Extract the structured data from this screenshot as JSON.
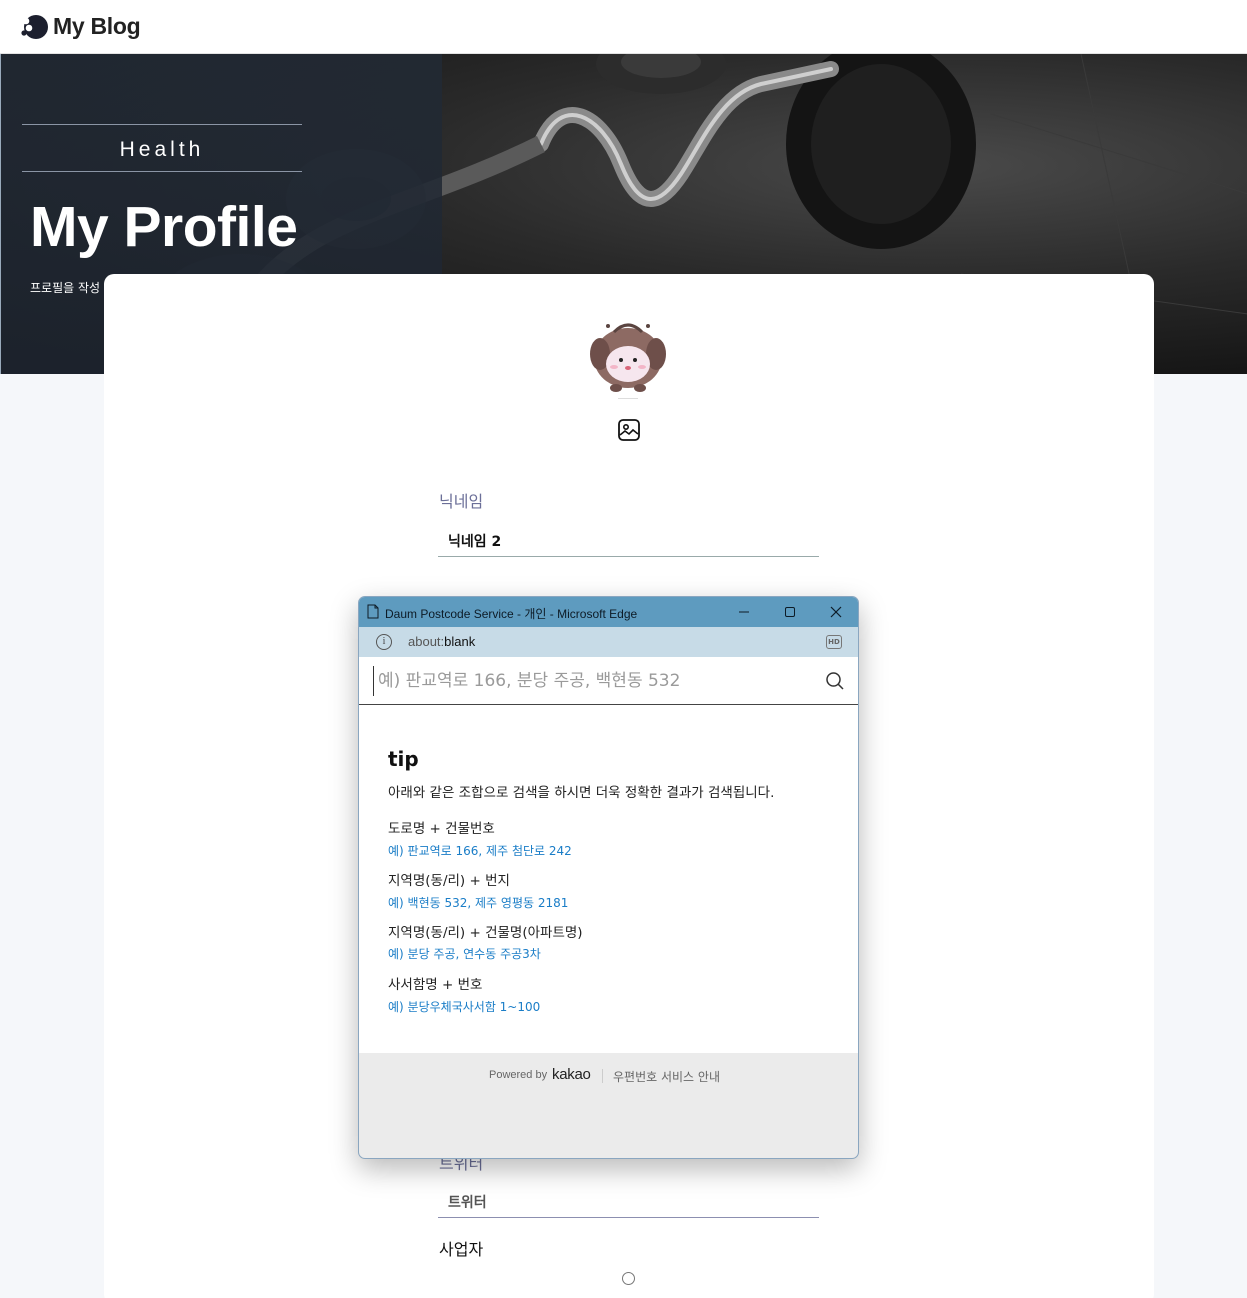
{
  "nav": {
    "logo_text": "My Blog"
  },
  "hero": {
    "category": "Health",
    "title": "My Profile",
    "subtitle": "프로필을 작성"
  },
  "profile": {
    "nickname_label": "닉네임",
    "nickname_value": "닉네임 2",
    "twitter_label": "트위터",
    "twitter_placeholder": "트위터",
    "business_label": "사업자"
  },
  "popup": {
    "window_title": "Daum Postcode Service - 개인 - Microsoft Edge",
    "url_prefix": "about:",
    "url_main": "blank",
    "hd_badge": "HD",
    "search_placeholder": "예) 판교역로 166, 분당 주공, 백현동 532",
    "tip_title": "tip",
    "tip_desc": "아래와 같은 조합으로 검색을 하시면 더욱 정확한 결과가 검색됩니다.",
    "tips": [
      {
        "heading": "도로명 + 건물번호",
        "example": "예) 판교역로 166,  제주 첨단로 242"
      },
      {
        "heading": "지역명(동/리) + 번지",
        "example": "예) 백현동 532,  제주 영평동 2181"
      },
      {
        "heading": "지역명(동/리) + 건물명(아파트명)",
        "example": "예) 분당 주공,  연수동 주공3차"
      },
      {
        "heading": "사서함명 + 번호",
        "example": "예) 분당우체국사서함 1~100"
      }
    ],
    "powered_by": "Powered by",
    "brand": "kakao",
    "service_link": "우편번호 서비스 안내"
  },
  "colors": {
    "accent_label": "#6b6f98",
    "tip_example": "#1a7dc7",
    "popup_titlebar": "#5e9bbf",
    "popup_urlbar": "#c7dbe7"
  }
}
